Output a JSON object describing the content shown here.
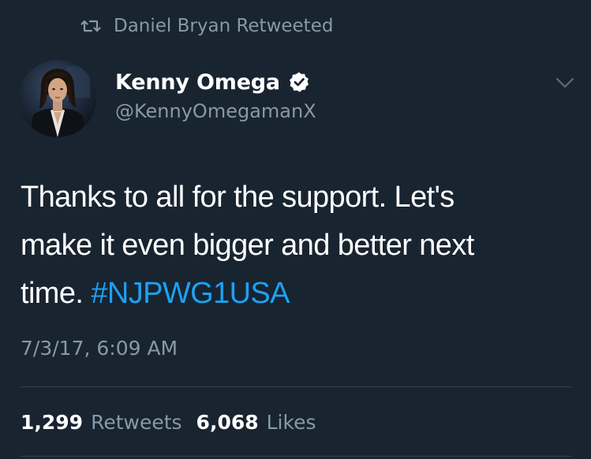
{
  "retweet": {
    "icon": "retweet-icon",
    "text": "Daniel Bryan Retweeted"
  },
  "author": {
    "name": "Kenny Omega",
    "verified": true,
    "handle": "@KennyOmegamanX",
    "avatar": "avatar-photo"
  },
  "tweet": {
    "line1": "Thanks to all for the support. Let's",
    "line2": "make it even bigger and better next",
    "line3_prefix": "time. ",
    "hashtag": "#NJPWG1USA",
    "timestamp": "7/3/17, 6:09 AM"
  },
  "stats": {
    "retweets_count": "1,299",
    "retweets_label": "Retweets",
    "likes_count": "6,068",
    "likes_label": "Likes"
  },
  "colors": {
    "background": "#182430",
    "secondary_text": "#8899a6",
    "hashtag": "#1da1f2",
    "divider": "#38444d"
  }
}
